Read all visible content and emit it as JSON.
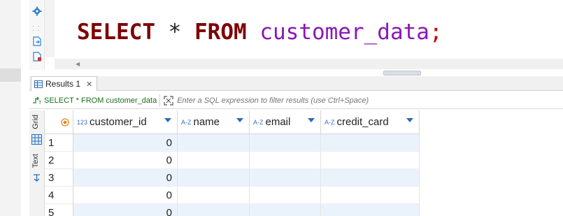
{
  "editor": {
    "sql": {
      "kw_select": "SELECT",
      "star": "*",
      "kw_from": "FROM",
      "table": "customer_data",
      "semicolon": ";"
    }
  },
  "results": {
    "tab_label": "Results 1",
    "close_glyph": "✕",
    "filter": {
      "query_label": "SELECT * FROM customer_data",
      "placeholder": "Enter a SQL expression to filter results (use Ctrl+Space)"
    },
    "side_tabs": [
      "Grid",
      "Text"
    ],
    "columns": [
      {
        "type": "123",
        "name": "customer_id"
      },
      {
        "type": "A-Z",
        "name": "name"
      },
      {
        "type": "A-Z",
        "name": "email"
      },
      {
        "type": "A-Z",
        "name": "credit_card"
      }
    ],
    "rows": [
      {
        "num": "1",
        "customer_id": "0",
        "name": "",
        "email": "",
        "credit_card": ""
      },
      {
        "num": "2",
        "customer_id": "0",
        "name": "",
        "email": "",
        "credit_card": ""
      },
      {
        "num": "3",
        "customer_id": "0",
        "name": "",
        "email": "",
        "credit_card": ""
      },
      {
        "num": "4",
        "customer_id": "0",
        "name": "",
        "email": "",
        "credit_card": ""
      },
      {
        "num": "5",
        "customer_id": "0",
        "name": "",
        "email": "",
        "credit_card": ""
      }
    ]
  },
  "colors": {
    "keyword": "#7f0000",
    "identifier": "#8a17b8",
    "semicolon": "#d40000",
    "row_highlight": "#eaf3fc",
    "type_badge": "#3b6fbf"
  }
}
